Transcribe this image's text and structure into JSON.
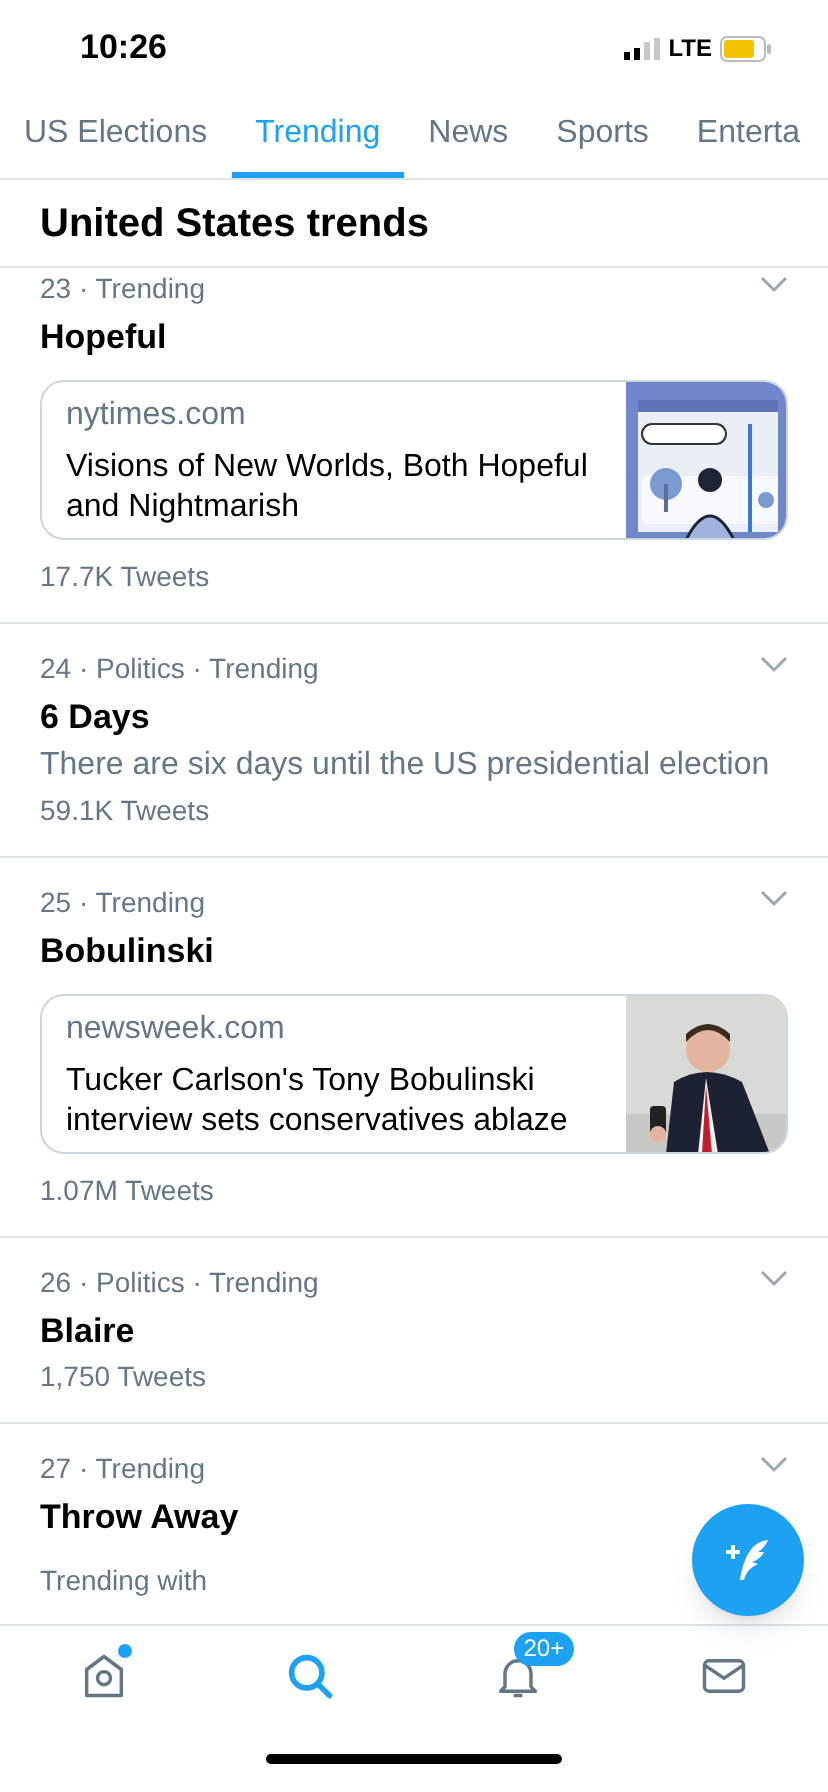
{
  "status_bar": {
    "time": "10:26",
    "network": "LTE"
  },
  "tabs": [
    {
      "label": "US Elections",
      "selected": false
    },
    {
      "label": "Trending",
      "selected": true
    },
    {
      "label": "News",
      "selected": false
    },
    {
      "label": "Sports",
      "selected": false
    },
    {
      "label": "Enterta",
      "selected": false
    }
  ],
  "header": {
    "title": "United States trends"
  },
  "trends": [
    {
      "rank": "23",
      "meta": "· Trending",
      "title": "Hopeful",
      "card": {
        "source": "nytimes.com",
        "headline": "Visions of New Worlds, Both Hopeful and Nightmarish",
        "kind": "picture"
      },
      "tweets": "17.7K Tweets"
    },
    {
      "rank": "24",
      "meta": "· Politics · Trending",
      "title": "6 Days",
      "description": "There are six days until the US presidential election",
      "tweets": "59.1K Tweets"
    },
    {
      "rank": "25",
      "meta": "· Trending",
      "title": "Bobulinski",
      "card": {
        "source": "newsweek.com",
        "headline": "Tucker Carlson's Tony Bobulinski interview sets conservatives ablaze",
        "kind": "picture"
      },
      "tweets": "1.07M Tweets"
    },
    {
      "rank": "26",
      "meta": "· Politics · Trending",
      "title": "Blaire",
      "tweets": "1,750 Tweets"
    },
    {
      "rank": "27",
      "meta": "· Trending",
      "title": "Throw Away",
      "footer": "Trending with"
    }
  ],
  "bottom_nav": [
    {
      "kind": "home",
      "selected": false,
      "dot": true
    },
    {
      "kind": "search",
      "selected": true
    },
    {
      "kind": "notifications",
      "selected": false,
      "badge": "20+"
    },
    {
      "kind": "messages",
      "selected": false
    }
  ]
}
